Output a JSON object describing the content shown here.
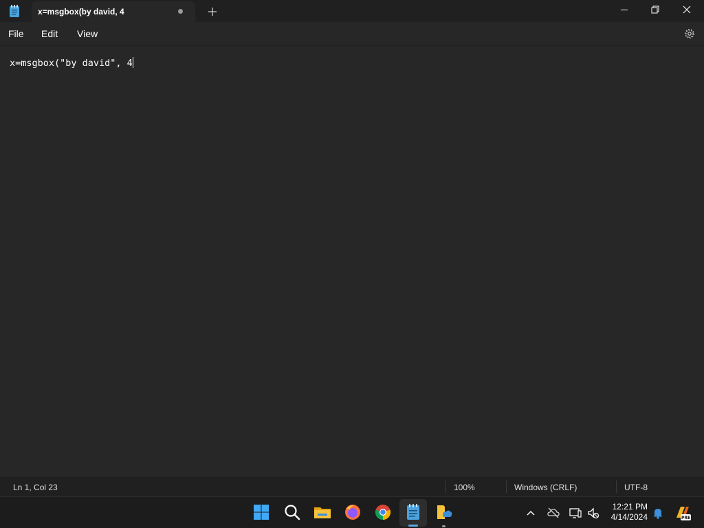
{
  "window": {
    "tab_title": "x=msgbox(by david, 4",
    "new_tab_symbol": "+"
  },
  "menu": {
    "file": "File",
    "edit": "Edit",
    "view": "View"
  },
  "editor": {
    "content": "x=msgbox(\"by david\", 4"
  },
  "status": {
    "position": "Ln 1, Col 23",
    "zoom": "100%",
    "line_endings": "Windows (CRLF)",
    "encoding": "UTF-8"
  },
  "taskbar": {
    "apps": [
      "start-icon",
      "search-icon",
      "file-explorer-icon",
      "firefox-icon",
      "chrome-icon",
      "notepad-icon",
      "onedrive-folder-icon"
    ],
    "active_app": "notepad-icon"
  },
  "tray": {
    "time": "12:21 PM",
    "date": "4/14/2024",
    "icons": [
      "chevron-up-icon",
      "cloud-offline-icon",
      "network-icon",
      "volume-muted-icon",
      "bell-icon",
      "copilot-pre-icon"
    ]
  },
  "colors": {
    "background": "#202020",
    "editor_bg": "#272727",
    "accent": "#5ca8e6"
  }
}
